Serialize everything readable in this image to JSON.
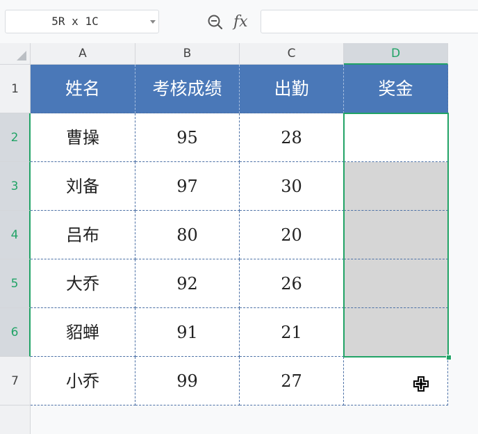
{
  "formula_bar": {
    "name_box": "5R x 1C",
    "zoom_icon": "zoom-icon",
    "fx_label": "fx",
    "formula": ""
  },
  "columns": [
    "A",
    "B",
    "C",
    "D"
  ],
  "rows": [
    "1",
    "2",
    "3",
    "4",
    "5",
    "6",
    "7"
  ],
  "table": {
    "header": [
      "姓名",
      "考核成绩",
      "出勤",
      "奖金"
    ],
    "body": [
      [
        "曹操",
        "95",
        "28",
        ""
      ],
      [
        "刘备",
        "97",
        "30",
        ""
      ],
      [
        "吕布",
        "80",
        "20",
        ""
      ],
      [
        "大乔",
        "92",
        "26",
        ""
      ],
      [
        "貂蝉",
        "91",
        "21",
        ""
      ],
      [
        "小乔",
        "99",
        "27",
        ""
      ]
    ]
  },
  "selection": {
    "range": "D2:D6"
  },
  "colors": {
    "header_bg": "#4a78b8",
    "selection": "#21a366",
    "fill_grey": "#d6d6d6"
  }
}
